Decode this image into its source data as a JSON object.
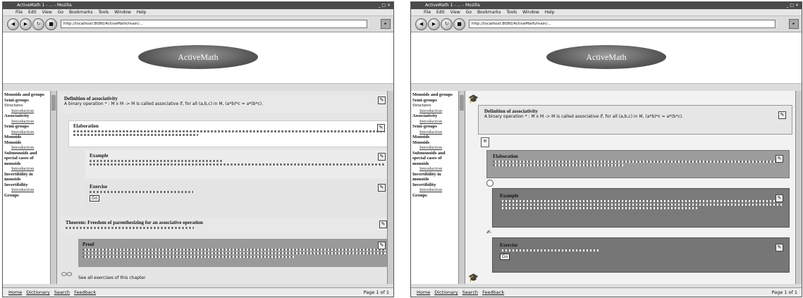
{
  "left": {
    "title": "ActiveMath 1 - ... - Mozilla",
    "menus": [
      "File",
      "Edit",
      "View",
      "Go",
      "Bookmarks",
      "Tools",
      "Window",
      "Help"
    ],
    "url": "http://localhost:8080/ActiveMath/main/...",
    "logo": "ActiveMath",
    "sidebar": [
      {
        "t": "Monoids and groups",
        "sec": true
      },
      {
        "t": "Semi-groups",
        "sec": true
      },
      {
        "t": "Structures",
        "sec": false
      },
      {
        "t": "Introduction",
        "sub": true
      },
      {
        "t": "Associativity",
        "sec": true
      },
      {
        "t": "Introduction",
        "sub": true
      },
      {
        "t": "Semi-groups",
        "sec": true
      },
      {
        "t": "Introduction",
        "sub": true
      },
      {
        "t": "Monoids",
        "sec": true
      },
      {
        "t": "Monoids",
        "sec": true
      },
      {
        "t": "Introduction",
        "sub": true
      },
      {
        "t": "Submonoids and special cases of monoids",
        "sec": true
      },
      {
        "t": "Introduction",
        "sub": true
      },
      {
        "t": "Invertibility in monoids",
        "sec": true
      },
      {
        "t": "Invertibility",
        "sec": true
      },
      {
        "t": "Introduction",
        "sub": true
      },
      {
        "t": "Groups",
        "sec": true
      }
    ],
    "def_title": "Definition of associativity",
    "def_text": "A binary operation * : M x M -> M is called associative if, for all (a,b,c) in M, (a*b)*c = a*(b*c).",
    "elab_title": "Elaboration",
    "example_title": "Example",
    "exercise_title": "Exercise",
    "theorem_title": "Theorem: Freedom of parenthesizing for an associative operation",
    "proof_title": "Proof",
    "footer_note": "See all exercises of this chapter",
    "status_links": [
      "Home",
      "Dictionary",
      "Search",
      "Feedback"
    ],
    "page": "Page 1 of 1"
  },
  "right": {
    "title": "ActiveMath 1 - ... - Mozilla",
    "menus": [
      "File",
      "Edit",
      "View",
      "Go",
      "Bookmarks",
      "Tools",
      "Window",
      "Help"
    ],
    "url": "http://localhost:8080/ActiveMath/main/...",
    "logo": "ActiveMath",
    "sidebar": [
      {
        "t": "Monoids and groups",
        "sec": true
      },
      {
        "t": "Semi-groups",
        "sec": true
      },
      {
        "t": "Structures",
        "sec": false
      },
      {
        "t": "Introduction",
        "sub": true
      },
      {
        "t": "Associativity",
        "sec": true
      },
      {
        "t": "Introduction",
        "sub": true
      },
      {
        "t": "Semi-groups",
        "sec": true
      },
      {
        "t": "Introduction",
        "sub": true
      },
      {
        "t": "Monoids",
        "sec": true
      },
      {
        "t": "Monoids",
        "sec": true
      },
      {
        "t": "Introduction",
        "sub": true
      },
      {
        "t": "Submonoids and special cases of monoids",
        "sec": true
      },
      {
        "t": "Introduction",
        "sub": true
      },
      {
        "t": "Invertibility in monoids",
        "sec": true
      },
      {
        "t": "Invertibility",
        "sec": true
      },
      {
        "t": "Introduction",
        "sub": true
      },
      {
        "t": "Groups",
        "sec": true
      }
    ],
    "def_title": "Definition of associativity",
    "def_text": "A binary operation * : M x M -> M is called associative if, for all (a,b,c) in M, (a*b)*c = a*(b*c).",
    "elab_title": "Elaboration",
    "example_title": "Example",
    "exercise_title": "Exercise",
    "status_links": [
      "Home",
      "Dictionary",
      "Search",
      "Feedback"
    ],
    "page": "Page 1 of 1"
  },
  "shared": {
    "mini_button": "Go"
  }
}
